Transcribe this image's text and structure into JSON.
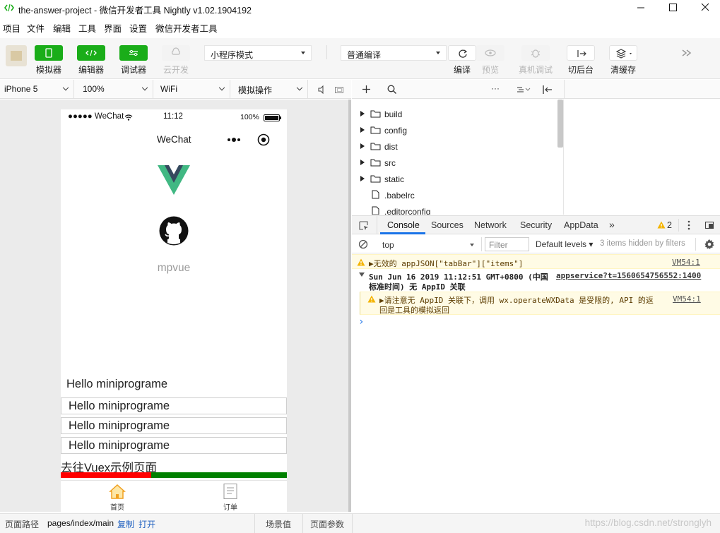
{
  "window": {
    "title": "the-answer-project - 微信开发者工具 Nightly v1.02.1904192"
  },
  "menu": [
    "项目",
    "文件",
    "编辑",
    "工具",
    "界面",
    "设置",
    "微信开发者工具"
  ],
  "toolbar": {
    "simulator": "模拟器",
    "editor": "编辑器",
    "debugger": "调试器",
    "cloud": "云开发",
    "mode": "小程序模式",
    "compile_mode": "普通编译",
    "compile": "编译",
    "preview": "预览",
    "remote_debug": "真机调试",
    "background": "切后台",
    "clear_cache": "清缓存"
  },
  "device_bar": {
    "device": "iPhone 5",
    "zoom": "100%",
    "network": "WiFi",
    "operation": "模拟操作"
  },
  "phone": {
    "carrier": "●●●●● WeChat",
    "time": "11:12",
    "battery": "100%",
    "nav_title": "WeChat",
    "app_name": "mpvue",
    "hello_lines": [
      "Hello miniprograme",
      "Hello miniprograme",
      "Hello miniprograme",
      "Hello miniprograme"
    ],
    "vuex_link": "去往Vuex示例页面",
    "progress": 0.4,
    "tabs": [
      "首页",
      "订单"
    ]
  },
  "file_tree": [
    {
      "name": "build",
      "type": "folder"
    },
    {
      "name": "config",
      "type": "folder"
    },
    {
      "name": "dist",
      "type": "folder"
    },
    {
      "name": "src",
      "type": "folder"
    },
    {
      "name": "static",
      "type": "folder"
    },
    {
      "name": ".babelrc",
      "type": "file"
    },
    {
      "name": ".editorconfig",
      "type": "file"
    }
  ],
  "devtools": {
    "tabs": [
      "Console",
      "Sources",
      "Network",
      "Security",
      "AppData"
    ],
    "warning_count": "2",
    "context": "top",
    "filter_placeholder": "Filter",
    "levels": "Default levels",
    "hidden": "3 items hidden by filters"
  },
  "console": {
    "line1": "▶无效的 appJSON[\"tabBar\"][\"items\"]",
    "line1_src": "VM54:1",
    "line2a": "Sun Jun 16 2019 11:12:51 GMT+0800 (中国",
    "line2_src": "appservice?t=1560654756552:1400",
    "line2b": "标准时间) 无 AppID 关联",
    "line3a": "▶请注意无 AppID 关联下，调用 wx.operateWXData 是受限的, API 的返",
    "line3_src": "VM54:1",
    "line3b": "回是工具的模拟返回",
    "prompt": "›"
  },
  "statusbar": {
    "path_label": "页面路径",
    "path": "pages/index/main",
    "copy": "复制",
    "open": "打开",
    "scene": "场景值",
    "params": "页面参数",
    "watermark": "https://blog.csdn.net/stronglyh"
  },
  "colors": {
    "green": "#1aad19",
    "progress_red": "#ff0000",
    "progress_green": "#008000",
    "warning_bg": "#fffbe5"
  }
}
